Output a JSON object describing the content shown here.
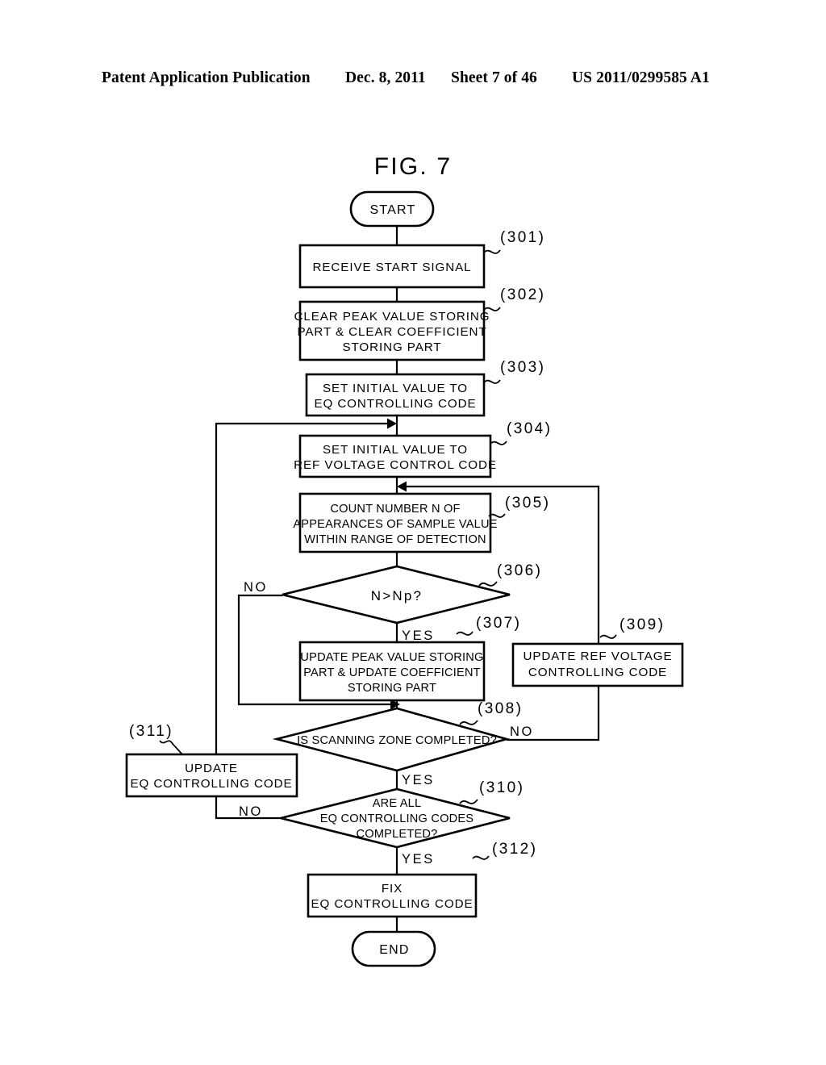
{
  "header": {
    "publication": "Patent Application Publication",
    "date": "Dec. 8, 2011",
    "sheet": "Sheet 7 of 46",
    "patent_number": "US 2011/0299585 A1"
  },
  "figure": {
    "title": "FIG. 7",
    "terminators": {
      "start": "START",
      "end": "END"
    },
    "nodes": [
      {
        "ref": "(301)",
        "type": "process",
        "lines": [
          "RECEIVE START SIGNAL"
        ]
      },
      {
        "ref": "(302)",
        "type": "process",
        "lines": [
          "CLEAR PEAK VALUE STORING",
          "PART & CLEAR COEFFICIENT",
          "STORING PART"
        ]
      },
      {
        "ref": "(303)",
        "type": "process",
        "lines": [
          "SET INITIAL VALUE TO",
          "EQ CONTROLLING CODE"
        ]
      },
      {
        "ref": "(304)",
        "type": "process",
        "lines": [
          "SET INITIAL VALUE TO",
          "REF VOLTAGE CONTROL CODE"
        ]
      },
      {
        "ref": "(305)",
        "type": "process",
        "lines": [
          "COUNT NUMBER N OF",
          "APPEARANCES OF SAMPLE VALUE",
          "WITHIN RANGE OF DETECTION"
        ]
      },
      {
        "ref": "(306)",
        "type": "decision",
        "lines": [
          "N>Np?"
        ]
      },
      {
        "ref": "(307)",
        "type": "process",
        "lines": [
          "UPDATE PEAK VALUE STORING",
          "PART & UPDATE COEFFICIENT",
          "STORING PART"
        ]
      },
      {
        "ref": "(308)",
        "type": "decision",
        "lines": [
          "IS SCANNING ZONE COMPLETED?"
        ]
      },
      {
        "ref": "(309)",
        "type": "process",
        "lines": [
          "UPDATE REF VOLTAGE",
          "CONTROLLING CODE"
        ]
      },
      {
        "ref": "(310)",
        "type": "decision",
        "lines": [
          "ARE ALL",
          "EQ CONTROLLING CODES",
          "COMPLETED?"
        ]
      },
      {
        "ref": "(311)",
        "type": "process",
        "lines": [
          "UPDATE",
          "EQ CONTROLLING CODE"
        ]
      },
      {
        "ref": "(312)",
        "type": "process",
        "lines": [
          "FIX",
          "EQ CONTROLLING CODE"
        ]
      }
    ],
    "branches": {
      "d306_no": "NO",
      "d306_yes": "YES",
      "d308_no": "NO",
      "d308_yes": "YES",
      "d310_no": "NO",
      "d310_yes": "YES"
    }
  }
}
